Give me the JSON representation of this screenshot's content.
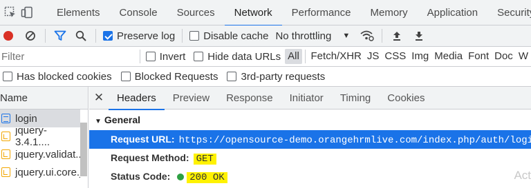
{
  "tabs": [
    "Elements",
    "Console",
    "Sources",
    "Network",
    "Performance",
    "Memory",
    "Application",
    "Security"
  ],
  "toolbar": {
    "preserve_log": "Preserve log",
    "disable_cache": "Disable cache",
    "throttling": "No throttling"
  },
  "filter": {
    "placeholder": "Filter",
    "invert": "Invert",
    "hide_data_urls": "Hide data URLs",
    "types": [
      "All",
      "Fetch/XHR",
      "JS",
      "CSS",
      "Img",
      "Media",
      "Font",
      "Doc",
      "W"
    ]
  },
  "blocked": {
    "has_blocked_cookies": "Has blocked cookies",
    "blocked_requests": "Blocked Requests",
    "third_party": "3rd-party requests"
  },
  "request_list": {
    "header": "Name",
    "items": [
      "login",
      "jquery-3.4.1....",
      "jquery.validat...",
      "jquery.ui.core.j"
    ]
  },
  "detail": {
    "tabs": [
      "Headers",
      "Preview",
      "Response",
      "Initiator",
      "Timing",
      "Cookies"
    ],
    "section": "General",
    "rows": [
      {
        "key": "Request URL:",
        "value": "https://opensource-demo.orangehrmlive.com/index.php/auth/login"
      },
      {
        "key": "Request Method:",
        "value": "GET"
      },
      {
        "key": "Status Code:",
        "value": "200 OK"
      }
    ],
    "watermark": "Act"
  },
  "colors": {
    "accent": "#1a73e8",
    "record": "#d93025",
    "highlight": "#fff200",
    "status_ok": "#2ea043"
  },
  "icons": [
    "inspect-element-icon",
    "device-toolbar-icon",
    "record-icon",
    "clear-icon",
    "filter-icon",
    "search-icon",
    "dropdown-arrow-icon",
    "network-conditions-icon",
    "upload-icon",
    "download-icon",
    "close-icon",
    "document-icon",
    "script-icon",
    "status-dot-icon"
  ]
}
